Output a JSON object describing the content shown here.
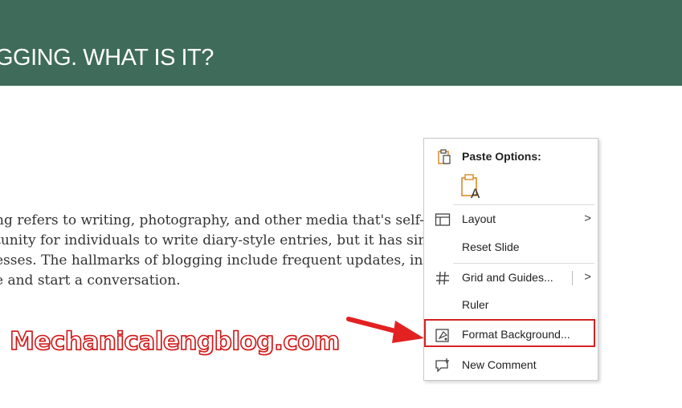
{
  "slide": {
    "title": "GGING. WHAT IS IT?",
    "body_lines": [
      "ng refers to writing, photography, and other media that's self-p                                   started as an",
      "tunity for individuals to write diary-style entries, but it has sin                                   o websites fo",
      "esses. The hallmarks of blogging include frequent updates, infor                                   nities for re",
      "e and start a conversation."
    ]
  },
  "watermark": "Mechanicalengblog.com",
  "colors": {
    "header_bg": "#3e6b5a",
    "highlight": "#d62222",
    "arrow": "#e32121",
    "paste_icon": "#d88a2a"
  },
  "context_menu": {
    "paste_options_label": "Paste Options:",
    "items": [
      {
        "label": "Layout",
        "icon": "layout-icon",
        "has_submenu": true
      },
      {
        "label": "Reset Slide",
        "icon": "",
        "has_submenu": false
      },
      {
        "label": "Grid and Guides...",
        "icon": "grid-icon",
        "has_submenu": true
      },
      {
        "label": "Ruler",
        "icon": "",
        "has_submenu": false
      },
      {
        "label": "Format Background...",
        "icon": "format-background-icon",
        "has_submenu": false
      },
      {
        "label": "New Comment",
        "icon": "new-comment-icon",
        "has_submenu": false
      }
    ]
  }
}
